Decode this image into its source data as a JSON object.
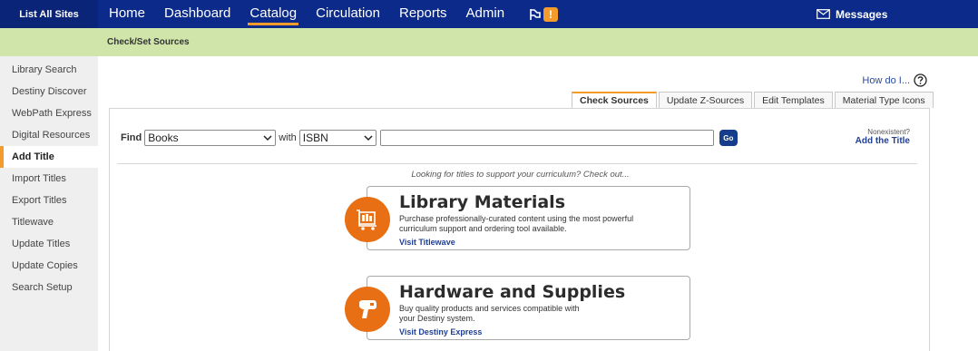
{
  "topbar": {
    "list_all_sites": "List All Sites",
    "nav": [
      {
        "label": "Home"
      },
      {
        "label": "Dashboard"
      },
      {
        "label": "Catalog"
      },
      {
        "label": "Circulation"
      },
      {
        "label": "Reports"
      },
      {
        "label": "Admin"
      }
    ],
    "alert_badge": "!",
    "messages_label": "Messages"
  },
  "subbar": {
    "title": "Check/Set Sources"
  },
  "sidebar": {
    "items": [
      {
        "label": "Library Search"
      },
      {
        "label": "Destiny Discover"
      },
      {
        "label": "WebPath Express"
      },
      {
        "label": "Digital Resources"
      },
      {
        "label": "Add Title"
      },
      {
        "label": "Import Titles"
      },
      {
        "label": "Export Titles"
      },
      {
        "label": "Titlewave"
      },
      {
        "label": "Update Titles"
      },
      {
        "label": "Update Copies"
      },
      {
        "label": "Search Setup"
      }
    ]
  },
  "help": {
    "label": "How do I..."
  },
  "tabs": [
    {
      "label": "Check Sources"
    },
    {
      "label": "Update Z-Sources"
    },
    {
      "label": "Edit Templates"
    },
    {
      "label": "Material Type Icons"
    }
  ],
  "find": {
    "label": "Find",
    "type_value": "Books",
    "with_label": "with",
    "field_value": "ISBN",
    "query_value": "",
    "go_label": "Go"
  },
  "nonexistent": {
    "question": "Nonexistent?",
    "link": "Add the Title"
  },
  "curriculum_note": "Looking for titles to support your curriculum? Check out...",
  "promos": [
    {
      "title": "Library Materials",
      "desc": "Purchase professionally-curated content using the most powerful curriculum support and ordering tool available.",
      "link": "Visit Titlewave"
    },
    {
      "title": "Hardware and Supplies",
      "desc": "Buy quality products and services compatible with your Destiny system.",
      "link": "Visit Destiny Express"
    }
  ],
  "colors": {
    "nav_bg": "#0b2a8a",
    "accent": "#f39c2b",
    "subbar_bg": "#cfe5a9",
    "promo_icon": "#e86f14"
  }
}
